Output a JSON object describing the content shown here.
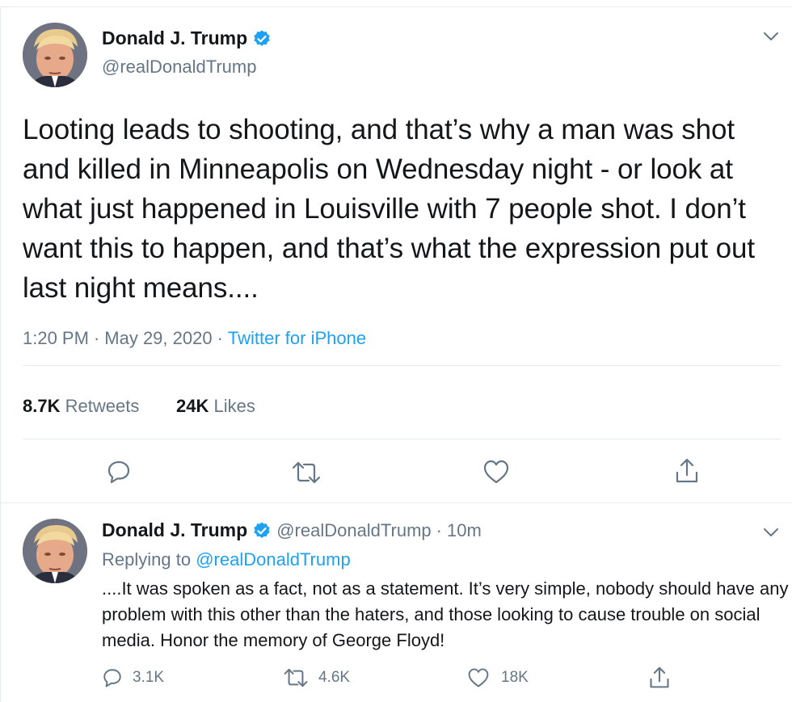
{
  "tweet": {
    "author_name": "Donald J. Trump",
    "handle": "@realDonaldTrump",
    "text": "Looting leads to shooting, and that’s why a man was shot and killed in Minneapolis on Wednesday night - or look at what just happened in Louisville with 7 people shot. I don’t want this to happen, and that’s what the expression put out last night means....",
    "time": "1:20 PM",
    "date": "May 29, 2020",
    "source": "Twitter for iPhone",
    "retweets_count": "8.7K",
    "retweets_label": "Retweets",
    "likes_count": "24K",
    "likes_label": "Likes"
  },
  "reply": {
    "author_name": "Donald J. Trump",
    "handle": "@realDonaldTrump",
    "age": "10m",
    "replying_prefix": "Replying to",
    "replying_to": "@realDonaldTrump",
    "text": "....It was spoken as a fact, not as a statement. It’s very simple, nobody should have any problem with this other than the haters, and those looking to cause trouble on social media. Honor the memory of George Floyd!",
    "reply_count": "3.1K",
    "retweet_count": "4.6K",
    "like_count": "18K"
  },
  "icons": {
    "verified": "verified-badge-icon",
    "chevron": "chevron-down-icon",
    "reply": "reply-icon",
    "retweet": "retweet-icon",
    "like": "heart-icon",
    "share": "share-icon"
  },
  "colors": {
    "accent": "#1da1f2",
    "text": "#14171a",
    "muted": "#657786",
    "divider": "#e6ecf0"
  }
}
